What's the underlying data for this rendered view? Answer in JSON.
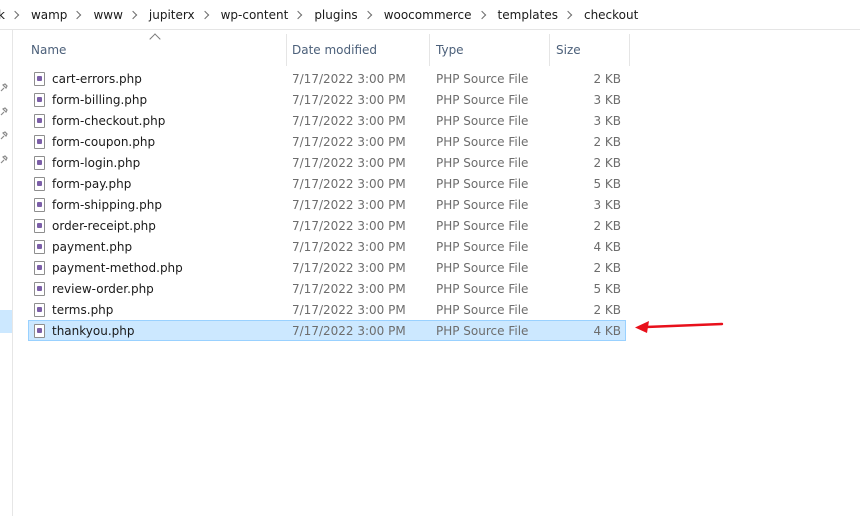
{
  "breadcrumb": {
    "items": [
      "k",
      "wamp",
      "www",
      "jupiterx",
      "wp-content",
      "plugins",
      "woocommerce",
      "templates",
      "checkout"
    ]
  },
  "columns": {
    "name": "Name",
    "date": "Date modified",
    "type": "Type",
    "size": "Size"
  },
  "files": [
    {
      "name": "cart-errors.php",
      "date": "7/17/2022 3:00 PM",
      "type": "PHP Source File",
      "size": "2 KB"
    },
    {
      "name": "form-billing.php",
      "date": "7/17/2022 3:00 PM",
      "type": "PHP Source File",
      "size": "3 KB"
    },
    {
      "name": "form-checkout.php",
      "date": "7/17/2022 3:00 PM",
      "type": "PHP Source File",
      "size": "3 KB"
    },
    {
      "name": "form-coupon.php",
      "date": "7/17/2022 3:00 PM",
      "type": "PHP Source File",
      "size": "2 KB"
    },
    {
      "name": "form-login.php",
      "date": "7/17/2022 3:00 PM",
      "type": "PHP Source File",
      "size": "2 KB"
    },
    {
      "name": "form-pay.php",
      "date": "7/17/2022 3:00 PM",
      "type": "PHP Source File",
      "size": "5 KB"
    },
    {
      "name": "form-shipping.php",
      "date": "7/17/2022 3:00 PM",
      "type": "PHP Source File",
      "size": "3 KB"
    },
    {
      "name": "order-receipt.php",
      "date": "7/17/2022 3:00 PM",
      "type": "PHP Source File",
      "size": "2 KB"
    },
    {
      "name": "payment.php",
      "date": "7/17/2022 3:00 PM",
      "type": "PHP Source File",
      "size": "4 KB"
    },
    {
      "name": "payment-method.php",
      "date": "7/17/2022 3:00 PM",
      "type": "PHP Source File",
      "size": "2 KB"
    },
    {
      "name": "review-order.php",
      "date": "7/17/2022 3:00 PM",
      "type": "PHP Source File",
      "size": "5 KB"
    },
    {
      "name": "terms.php",
      "date": "7/17/2022 3:00 PM",
      "type": "PHP Source File",
      "size": "2 KB"
    },
    {
      "name": "thankyou.php",
      "date": "7/17/2022 3:00 PM",
      "type": "PHP Source File",
      "size": "4 KB",
      "selected": true
    }
  ],
  "colors": {
    "selection": "#cce8ff",
    "selection_border": "#99d1ff",
    "annotation_arrow": "#e8101b",
    "header_text": "#4c607a"
  },
  "icons": {
    "file": "php-file-icon",
    "pin": "pin-icon",
    "sort": "sort-ascending-icon",
    "separator": "chevron-right-icon"
  }
}
